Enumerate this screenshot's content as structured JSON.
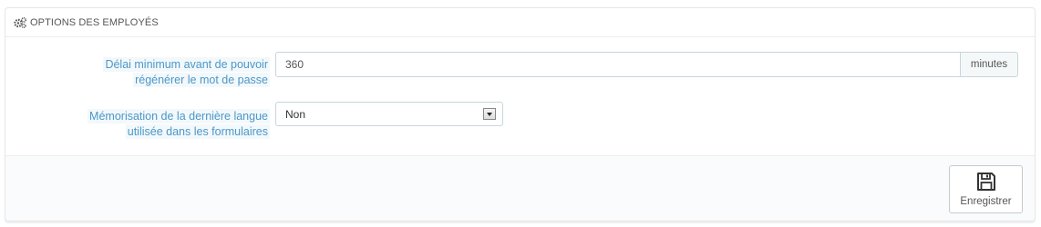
{
  "panel": {
    "heading_icon": "cogs-icon",
    "heading": "OPTIONS DES EMPLOYÉS"
  },
  "fields": {
    "password_delay": {
      "label_line1": "Délai minimum avant de pouvoir",
      "label_line2": "régénérer le mot de passe",
      "value": "360",
      "suffix": "minutes"
    },
    "remember_language": {
      "label_line1": "Mémorisation de la dernière langue",
      "label_line2": "utilisée dans les formulaires",
      "selected": "Non"
    }
  },
  "footer": {
    "save_icon": "floppy-disk-icon",
    "save_label": "Enregistrer"
  },
  "colors": {
    "label": "#4a98c9",
    "label_bg": "#f3f8fb",
    "border": "#c7d6db"
  }
}
